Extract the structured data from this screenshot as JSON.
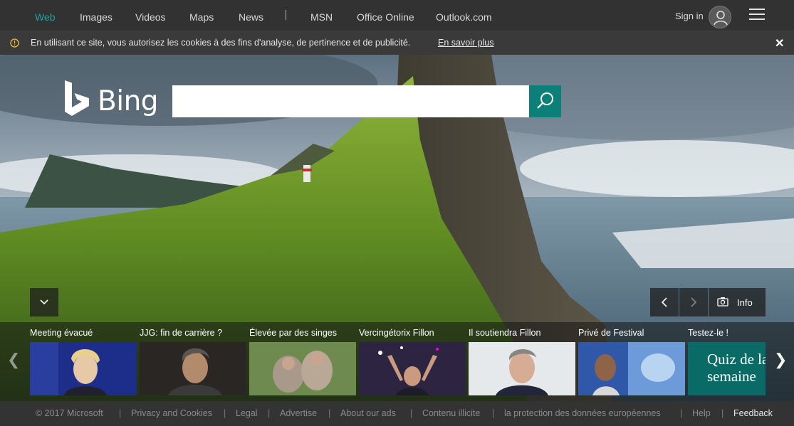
{
  "nav": {
    "items": [
      "Web",
      "Images",
      "Videos",
      "Maps",
      "News",
      "MSN",
      "Office Online",
      "Outlook.com"
    ],
    "signin": "Sign in"
  },
  "cookie": {
    "text": "En utilisant ce site, vous autorisez les cookies à des fins d'analyse, de pertinence et de publicité.",
    "link": "En savoir plus",
    "close": "✕"
  },
  "search": {
    "logo": "Bing",
    "value": "",
    "accent": "#0b7f78"
  },
  "image_info": {
    "label": "Info"
  },
  "carousel": {
    "tiles": [
      {
        "label": "Meeting évacué"
      },
      {
        "label": "JJG: fin de carrière ?"
      },
      {
        "label": "Élevée par des singes"
      },
      {
        "label": "Vercingétorix Fillon"
      },
      {
        "label": "Il soutiendra Fillon"
      },
      {
        "label": "Privé de Festival"
      },
      {
        "label": "Testez-le !",
        "quiz_line1": "Quiz de la",
        "quiz_line2": "semaine"
      }
    ]
  },
  "footer": {
    "copyright": "© 2017 Microsoft",
    "links": [
      "Privacy and Cookies",
      "Legal",
      "Advertise",
      "About our ads",
      "Contenu illicite",
      "la protection des données européennes",
      "Help"
    ],
    "feedback": "Feedback"
  }
}
